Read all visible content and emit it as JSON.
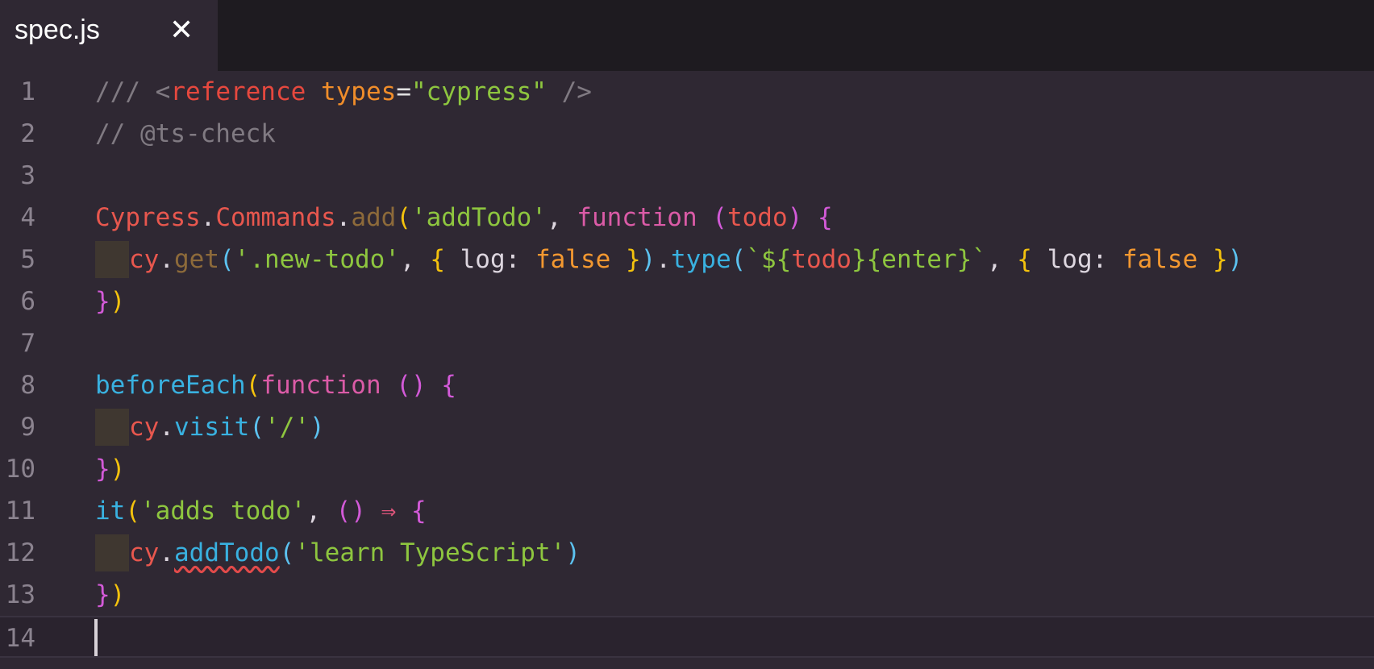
{
  "tab": {
    "title": "spec.js",
    "close_glyph": "✕"
  },
  "line_numbers": [
    "1",
    "2",
    "3",
    "4",
    "5",
    "6",
    "7",
    "8",
    "9",
    "10",
    "11",
    "12",
    "13",
    "14"
  ],
  "code": {
    "l1": {
      "a": "/// ",
      "b": "<",
      "c": "reference",
      "d": " ",
      "e": "types",
      "f": "=",
      "g": "\"cypress\"",
      "h": " />"
    },
    "l2": {
      "a": "// @ts-check"
    },
    "l4": {
      "a": "Cypress",
      "b": ".",
      "c": "Commands",
      "d": ".",
      "e": "add",
      "f": "(",
      "g": "'addTodo'",
      "h": ", ",
      "i": "function",
      "j": " ",
      "k": "(",
      "l": "todo",
      "m": ")",
      "n": " ",
      "o": "{"
    },
    "l5": {
      "a": "cy",
      "b": ".",
      "c": "get",
      "d": "(",
      "e": "'.new-todo'",
      "f": ", ",
      "g": "{",
      "h": " log: ",
      "i": "false",
      "j": " ",
      "k": "}",
      "l": ")",
      "m": ".",
      "n": "type",
      "o": "(",
      "p": "`$",
      "q": "{",
      "r": "todo",
      "s": "}{enter}",
      "t": "`",
      "u": ", ",
      "v": "{",
      "w": " log: ",
      "x": "false",
      "y": " ",
      "z": "}",
      "zz": ")"
    },
    "l6": {
      "a": "}",
      "b": ")"
    },
    "l8": {
      "a": "beforeEach",
      "b": "(",
      "c": "function",
      "d": " ",
      "e": "()",
      "f": " ",
      "g": "{"
    },
    "l9": {
      "a": "cy",
      "b": ".",
      "c": "visit",
      "d": "(",
      "e": "'/'",
      "f": ")"
    },
    "l10": {
      "a": "}",
      "b": ")"
    },
    "l11": {
      "a": "it",
      "b": "(",
      "c": "'adds todo'",
      "d": ", ",
      "e": "()",
      "f": " ",
      "g": "⇒",
      "h": " ",
      "i": "{"
    },
    "l12": {
      "a": "cy",
      "b": ".",
      "c": "addTodo",
      "d": "(",
      "e": "'learn TypeScript'",
      "f": ")"
    },
    "l13": {
      "a": "}",
      "b": ")"
    }
  },
  "colors": {
    "background": "#2f2833",
    "tabbar": "#1e1b20",
    "comment": "#807a82",
    "string": "#8ec63f",
    "keyword": "#db5ba7",
    "error_squiggle": "#e24a4a"
  },
  "icons": {
    "tab_close": "close-icon"
  }
}
